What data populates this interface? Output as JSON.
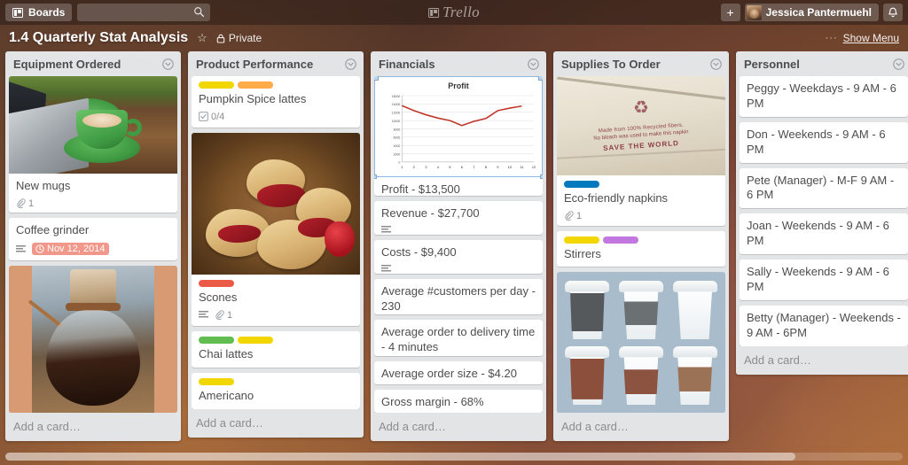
{
  "topbar": {
    "boards_label": "Boards",
    "boards_icon": "board-icon",
    "search_placeholder": "",
    "search_value": "",
    "search_icon": "search-icon",
    "logo_text": "Trello",
    "add_label": "+",
    "member_name": "Jessica Pantermuehl",
    "notifications_icon": "bell-icon"
  },
  "board_header": {
    "title": "1.4 Quarterly Stat Analysis",
    "star_icon": "star-icon",
    "visibility": "Private",
    "lock_icon": "lock-icon",
    "dots": "···",
    "show_menu": "Show Menu"
  },
  "colors": {
    "label_yellow": "#f2d600",
    "label_orange": "#ffab4a",
    "label_red": "#eb5a46",
    "label_green": "#61bd4f",
    "label_blue": "#0079bf",
    "label_purple": "#c377e0",
    "due_red": "#f2988a",
    "list_bg": "#e2e4e6",
    "card_bg": "#ffffff"
  },
  "add_card_label": "Add a card…",
  "lists": [
    {
      "title": "Equipment Ordered",
      "cards": [
        {
          "title": "New mugs",
          "cover": "coffee-mug-photo",
          "labels": [],
          "badges": [
            {
              "type": "attachment",
              "value": "1"
            }
          ]
        },
        {
          "title": "Coffee grinder",
          "labels": [],
          "badges": [
            {
              "type": "description",
              "value": ""
            },
            {
              "type": "due",
              "value": "Nov 12, 2014"
            }
          ]
        },
        {
          "title": "",
          "cover": "chemex-coffee-photo",
          "labels": [],
          "badges": []
        }
      ]
    },
    {
      "title": "Product Performance",
      "cards": [
        {
          "title": "Pumpkin Spice lattes",
          "labels": [
            "#f2d600",
            "#ffab4a"
          ],
          "badges": [
            {
              "type": "checklist",
              "value": "0/4"
            }
          ]
        },
        {
          "title": "Scones",
          "cover": "scones-photo",
          "labels": [
            "#eb5a46"
          ],
          "badges": [
            {
              "type": "description",
              "value": ""
            },
            {
              "type": "attachment",
              "value": "1"
            }
          ]
        },
        {
          "title": "Chai lattes",
          "labels": [
            "#61bd4f",
            "#f2d600"
          ],
          "badges": []
        },
        {
          "title": "Americano",
          "labels": [
            "#f2d600"
          ],
          "badges": []
        }
      ]
    },
    {
      "title": "Financials",
      "cards": [
        {
          "title": "Profit - $13,500",
          "cover": "profit-line-chart",
          "labels": [],
          "badges": [
            {
              "type": "attachment",
              "value": "1"
            }
          ]
        },
        {
          "title": "Revenue - $27,700",
          "labels": [],
          "badges": [
            {
              "type": "description",
              "value": ""
            }
          ]
        },
        {
          "title": "Costs - $9,400",
          "labels": [],
          "badges": [
            {
              "type": "description",
              "value": ""
            }
          ]
        },
        {
          "title": "Average #customers per day - 230",
          "labels": [],
          "badges": []
        },
        {
          "title": "Average order to delivery time - 4 minutes",
          "labels": [],
          "badges": []
        },
        {
          "title": "Average order size - $4.20",
          "labels": [],
          "badges": []
        },
        {
          "title": "Gross margin - 68%",
          "labels": [],
          "badges": []
        }
      ]
    },
    {
      "title": "Supplies To Order",
      "cards": [
        {
          "title": "Eco-friendly napkins",
          "cover": "recycled-napkin-photo",
          "cover_text": {
            "line1": "Made from 100% Recycled fibers.",
            "line2": "No bleach was used to make this napkin",
            "line3": "SAVE THE WORLD"
          },
          "labels": [
            "#0079bf"
          ],
          "badges": [
            {
              "type": "attachment",
              "value": "1"
            }
          ]
        },
        {
          "title": "Stirrers",
          "labels": [
            "#f2d600",
            "#c377e0"
          ],
          "badges": []
        },
        {
          "title": "",
          "cover": "paper-cups-illustration",
          "labels": [],
          "badges": []
        }
      ]
    },
    {
      "title": "Personnel",
      "cards": [
        {
          "title": "Peggy - Weekdays - 9 AM - 6 PM",
          "labels": [],
          "badges": []
        },
        {
          "title": "Don - Weekends - 9 AM - 6 PM",
          "labels": [],
          "badges": []
        },
        {
          "title": "Pete (Manager) - M-F 9 AM - 6 PM",
          "labels": [],
          "badges": []
        },
        {
          "title": "Joan - Weekends - 9 AM - 6 PM",
          "labels": [],
          "badges": []
        },
        {
          "title": "Sally - Weekends - 9 AM - 6 PM",
          "labels": [],
          "badges": []
        },
        {
          "title": "Betty (Manager) - Weekends - 9 AM - 6PM",
          "labels": [],
          "badges": []
        }
      ]
    }
  ],
  "chart_data": {
    "type": "line",
    "title": "Profit",
    "xlabel": "",
    "ylabel": "",
    "x": [
      1,
      2,
      3,
      4,
      5,
      6,
      7,
      8,
      9,
      10,
      11
    ],
    "xtick_labels": [
      "1",
      "2",
      "3",
      "4",
      "5",
      "6",
      "7",
      "8",
      "9",
      "10",
      "11",
      "12"
    ],
    "ytick_labels": [
      "0",
      "2000",
      "4000",
      "6000",
      "8000",
      "10000",
      "12000",
      "14000",
      "16000"
    ],
    "values": [
      13600,
      12400,
      11400,
      10600,
      10000,
      8800,
      9800,
      10500,
      12400,
      13000,
      13500
    ],
    "ylim": [
      0,
      16000
    ],
    "xlim": [
      1,
      12
    ],
    "grid": true,
    "legend": false,
    "series_color": "#c0392b"
  }
}
